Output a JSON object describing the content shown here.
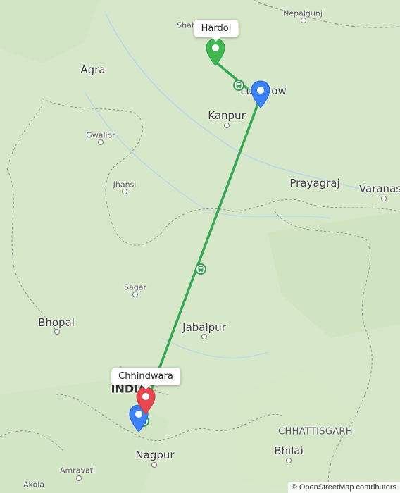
{
  "places": {
    "shah": "Shah",
    "nepalgunj": "Nepalgunj",
    "agra": "Agra",
    "lucknow": "Lucknow",
    "kanpur": "Kanpur",
    "gwalior": "Gwalior",
    "jhansi": "Jhansi",
    "prayagraj": "Prayagraj",
    "varanasi": "Varanas",
    "sagar": "Sagar",
    "bhopal": "Bhopal",
    "jabalpur": "Jabalpur",
    "india": "INDIA",
    "chhattisgarh": "CHHATTISGARH",
    "bhilai": "Bhilai",
    "nagpur": "Nagpur",
    "amravati": "Amravati",
    "akola": "Akola"
  },
  "callouts": {
    "hardoi": "Hardoi",
    "chhindwara": "Chhindwara"
  },
  "route": {
    "color": "#34a853",
    "stops": [
      "Hardoi",
      "Lucknow",
      "Chhindwara"
    ]
  },
  "markers": {
    "start_color": "#3fb950",
    "waypoint_color": "#3b82f6",
    "destination_color": "#e5484d"
  },
  "attribution": "© OpenStreetMap contributors"
}
